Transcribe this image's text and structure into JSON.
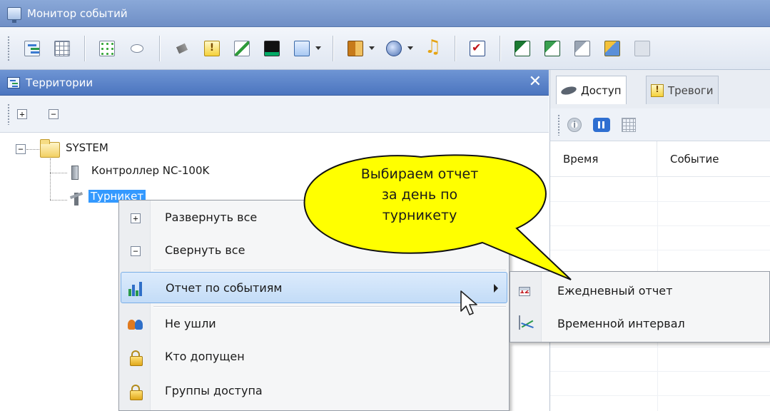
{
  "window": {
    "title": "Монитор событий"
  },
  "toolbar": {
    "icons": [
      "tree-view-icon",
      "grid-icon",
      "dots-icon",
      "link-icon",
      "pipe-icon",
      "alarm-icon",
      "edit-icon",
      "terminal-icon",
      "search-icon",
      "door-icon",
      "camera-icon",
      "music-icon",
      "checkbox-icon",
      "export-icon",
      "export-icon",
      "export-icon",
      "export-icon",
      "export-icon"
    ]
  },
  "left_panel": {
    "title": "Территории",
    "expand_label": "+",
    "collapse_label": "−",
    "tree": {
      "root": "SYSTEM",
      "children": [
        "Контроллер NC-100K",
        "Турникет"
      ]
    }
  },
  "right_panel": {
    "tabs": [
      {
        "label": "Доступ"
      },
      {
        "label": "Тревоги"
      }
    ],
    "columns": [
      "Время",
      "Событие"
    ]
  },
  "context_menu": {
    "items": [
      {
        "label": "Развернуть все",
        "icon": "plus-box-icon"
      },
      {
        "label": "Свернуть все",
        "icon": "minus-box-icon"
      },
      {
        "label": "Отчет по событиям",
        "icon": "chart-icon",
        "has_submenu": true
      },
      {
        "label": "Не ушли",
        "icon": "users-icon"
      },
      {
        "label": "Кто допущен",
        "icon": "lock-icon"
      },
      {
        "label": "Группы доступа",
        "icon": "lock-icon"
      }
    ],
    "submenu": [
      {
        "label": "Ежедневный отчет",
        "icon": "calendar-icon",
        "calendar_day": "12"
      },
      {
        "label": "Временной интервал",
        "icon": "trend-icon"
      }
    ]
  },
  "callout": {
    "lines": [
      "Выбираем отчет",
      "за день по",
      "турникету"
    ],
    "fill": "#ffff00"
  },
  "colors": {
    "title_bar": "#7594cc",
    "panel_header": "#5b83c9",
    "selection": "#3399ff",
    "menu_highlight": "#c9e0f9"
  }
}
